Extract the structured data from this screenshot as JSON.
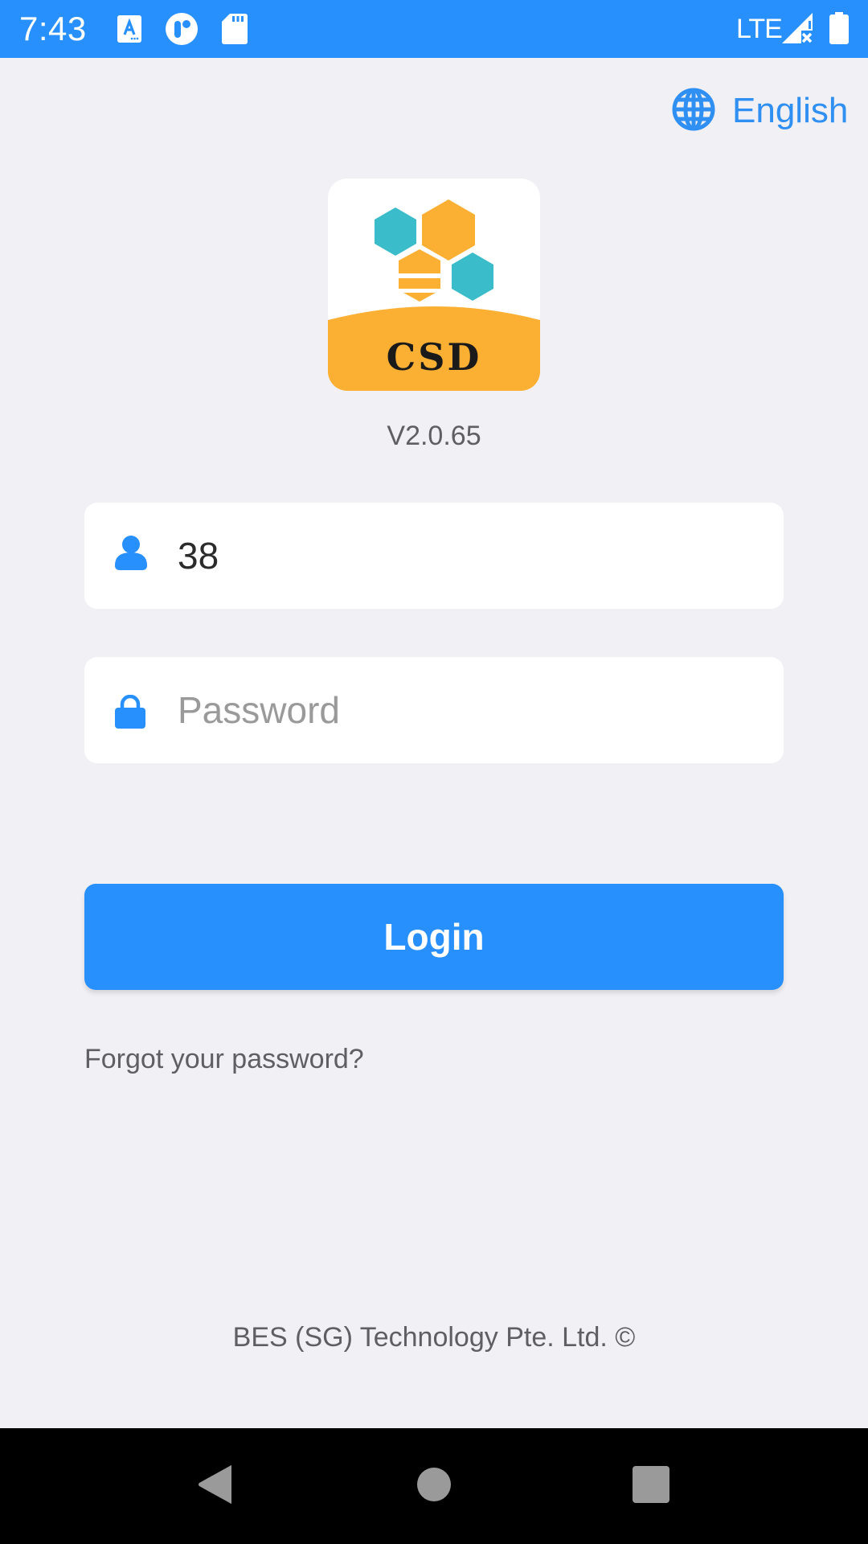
{
  "status_bar": {
    "time": "7:43",
    "notification_icons": [
      "accessibility-a-icon",
      "app-circle-icon",
      "sd-card-icon"
    ],
    "network": "LTE",
    "signal_icon": "signal-no-data-icon",
    "battery_icon": "battery-full-icon"
  },
  "language": {
    "icon": "globe-icon",
    "label": "English"
  },
  "logo": {
    "text": "CSD",
    "colors": {
      "orange": "#fbb034",
      "teal": "#3bbccb",
      "text": "#1a1a1a"
    }
  },
  "version": "V2.0.65",
  "form": {
    "username": {
      "icon": "user-icon",
      "value": "38",
      "placeholder": ""
    },
    "password": {
      "icon": "lock-icon",
      "value": "",
      "placeholder": "Password"
    },
    "login_label": "Login",
    "forgot_label": "Forgot your password?"
  },
  "footer": "BES (SG) Technology Pte. Ltd. ©",
  "nav_bar": {
    "back_icon": "back-triangle-icon",
    "home_icon": "home-circle-icon",
    "recents_icon": "recents-square-icon"
  },
  "colors": {
    "accent": "#2890fd",
    "background": "#f1f1f5",
    "link_text": "#2f8ff2",
    "muted_text": "#5e5e63"
  }
}
